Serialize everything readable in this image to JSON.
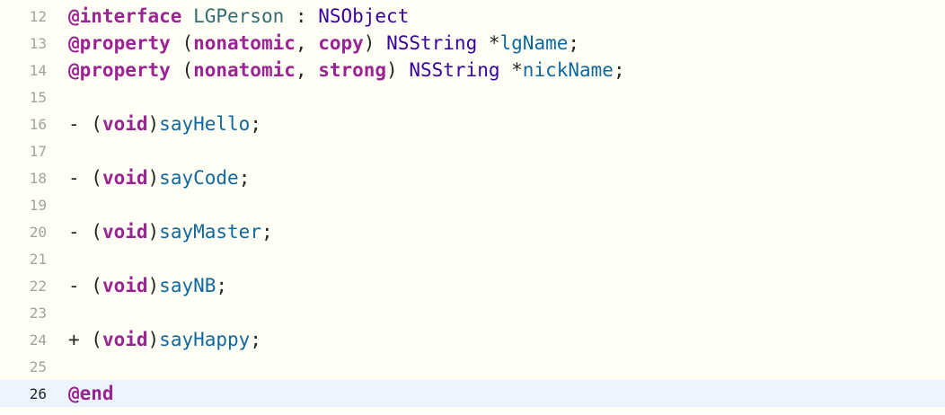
{
  "lines": [
    {
      "num": "12",
      "tokens": [
        {
          "t": "@interface",
          "c": "kw"
        },
        {
          "t": " ",
          "c": "plain"
        },
        {
          "t": "LGPerson",
          "c": "prj"
        },
        {
          "t": " : ",
          "c": "plain"
        },
        {
          "t": "NSObject",
          "c": "cls"
        }
      ]
    },
    {
      "num": "13",
      "tokens": [
        {
          "t": "@property",
          "c": "kw"
        },
        {
          "t": " (",
          "c": "plain"
        },
        {
          "t": "nonatomic",
          "c": "kw"
        },
        {
          "t": ", ",
          "c": "plain"
        },
        {
          "t": "copy",
          "c": "kw"
        },
        {
          "t": ") ",
          "c": "plain"
        },
        {
          "t": "NSString",
          "c": "cls"
        },
        {
          "t": " *",
          "c": "plain"
        },
        {
          "t": "lgName",
          "c": "ident"
        },
        {
          "t": ";",
          "c": "plain"
        }
      ]
    },
    {
      "num": "14",
      "tokens": [
        {
          "t": "@property",
          "c": "kw"
        },
        {
          "t": " (",
          "c": "plain"
        },
        {
          "t": "nonatomic",
          "c": "kw"
        },
        {
          "t": ", ",
          "c": "plain"
        },
        {
          "t": "strong",
          "c": "kw"
        },
        {
          "t": ") ",
          "c": "plain"
        },
        {
          "t": "NSString",
          "c": "cls"
        },
        {
          "t": " *",
          "c": "plain"
        },
        {
          "t": "nickName",
          "c": "ident"
        },
        {
          "t": ";",
          "c": "plain"
        }
      ]
    },
    {
      "num": "15",
      "tokens": []
    },
    {
      "num": "16",
      "tokens": [
        {
          "t": "- (",
          "c": "plain"
        },
        {
          "t": "void",
          "c": "kw"
        },
        {
          "t": ")",
          "c": "plain"
        },
        {
          "t": "sayHello",
          "c": "ident"
        },
        {
          "t": ";",
          "c": "plain"
        }
      ]
    },
    {
      "num": "17",
      "tokens": []
    },
    {
      "num": "18",
      "tokens": [
        {
          "t": "- (",
          "c": "plain"
        },
        {
          "t": "void",
          "c": "kw"
        },
        {
          "t": ")",
          "c": "plain"
        },
        {
          "t": "sayCode",
          "c": "ident"
        },
        {
          "t": ";",
          "c": "plain"
        }
      ]
    },
    {
      "num": "19",
      "tokens": []
    },
    {
      "num": "20",
      "tokens": [
        {
          "t": "- (",
          "c": "plain"
        },
        {
          "t": "void",
          "c": "kw"
        },
        {
          "t": ")",
          "c": "plain"
        },
        {
          "t": "sayMaster",
          "c": "ident"
        },
        {
          "t": ";",
          "c": "plain"
        }
      ]
    },
    {
      "num": "21",
      "tokens": []
    },
    {
      "num": "22",
      "tokens": [
        {
          "t": "- (",
          "c": "plain"
        },
        {
          "t": "void",
          "c": "kw"
        },
        {
          "t": ")",
          "c": "plain"
        },
        {
          "t": "sayNB",
          "c": "ident"
        },
        {
          "t": ";",
          "c": "plain"
        }
      ]
    },
    {
      "num": "23",
      "tokens": []
    },
    {
      "num": "24",
      "tokens": [
        {
          "t": "+ (",
          "c": "plain"
        },
        {
          "t": "void",
          "c": "kw"
        },
        {
          "t": ")",
          "c": "plain"
        },
        {
          "t": "sayHappy",
          "c": "ident"
        },
        {
          "t": ";",
          "c": "plain"
        }
      ]
    },
    {
      "num": "25",
      "tokens": []
    },
    {
      "num": "26",
      "current": true,
      "tokens": [
        {
          "t": "@end",
          "c": "kw"
        }
      ]
    }
  ]
}
